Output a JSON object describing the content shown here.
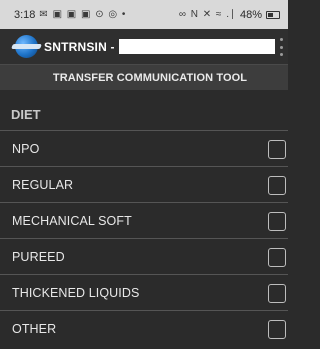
{
  "status_bar": {
    "time": "3:18",
    "left_icons": "✉ ▣ ▣ ▣ ⊙ ◎ •",
    "right_icons": "∞ N ✕ ≈ .∣",
    "battery": "48%"
  },
  "app_bar": {
    "title": "SNTRNSIN -",
    "input_value": ""
  },
  "subheader": {
    "title": "TRANSFER COMMUNICATION TOOL"
  },
  "section": {
    "title": "DIET"
  },
  "options": [
    {
      "label": "NPO",
      "checked": false
    },
    {
      "label": "REGULAR",
      "checked": false
    },
    {
      "label": "MECHANICAL SOFT",
      "checked": false
    },
    {
      "label": "PUREED",
      "checked": false
    },
    {
      "label": "THICKENED LIQUIDS",
      "checked": false
    },
    {
      "label": "OTHER",
      "checked": false
    }
  ]
}
